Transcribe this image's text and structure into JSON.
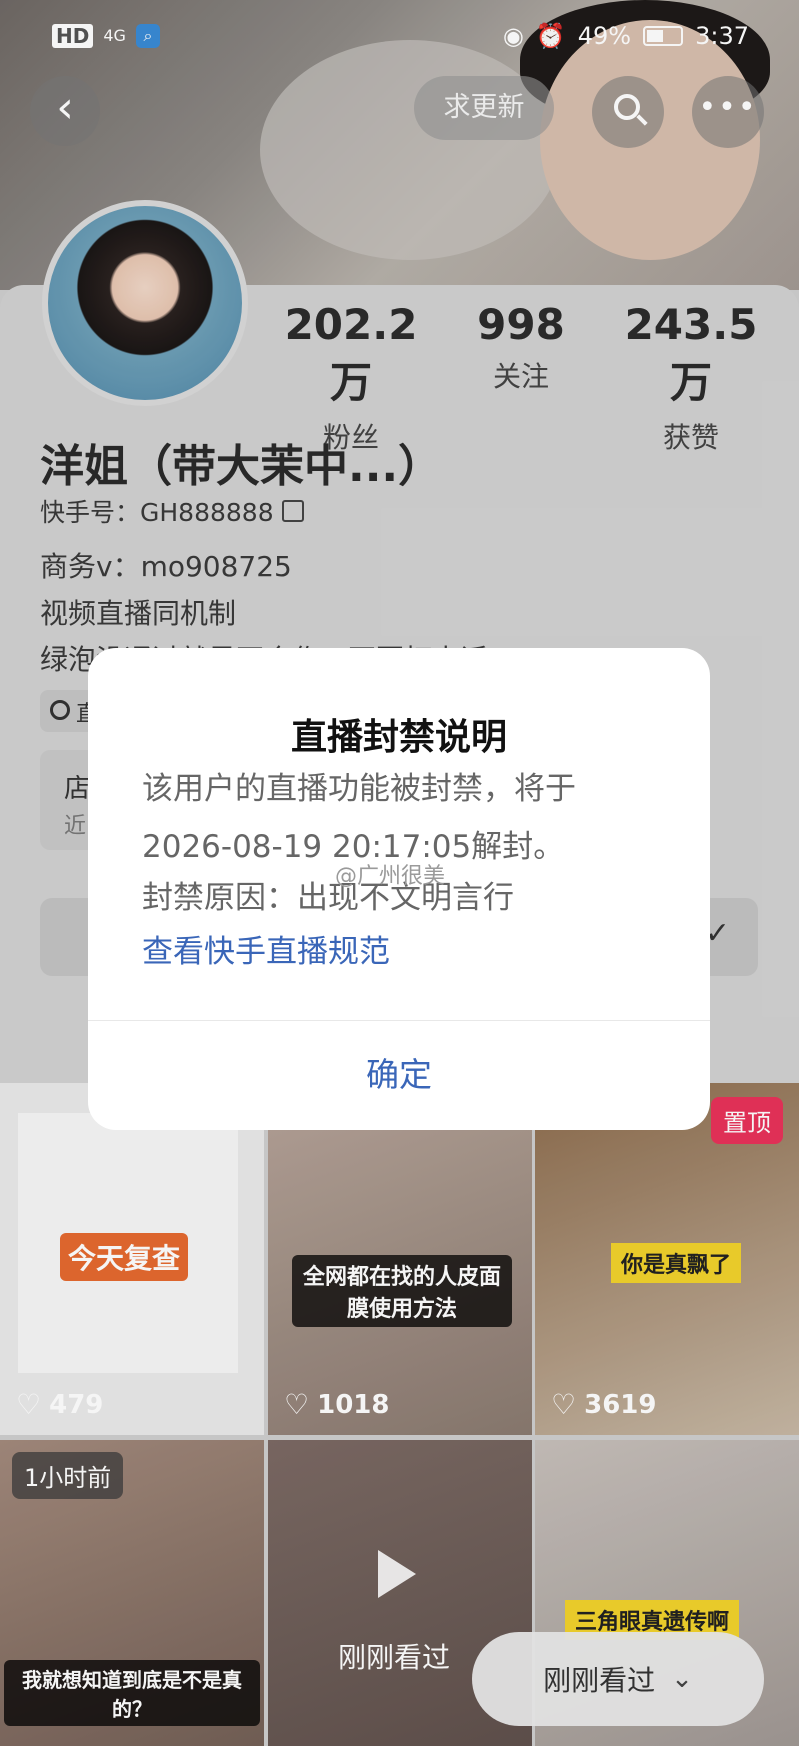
{
  "status_bar": {
    "network": "HD",
    "signal": "4G",
    "battery": "49%",
    "time": "3:37"
  },
  "header": {
    "back_icon": "chevron-left-icon",
    "update_label": "求更新",
    "search_icon": "search-icon",
    "more_icon": "more-icon"
  },
  "profile": {
    "stats": [
      {
        "value": "202.2万",
        "label": "粉丝"
      },
      {
        "value": "998",
        "label": "关注"
      },
      {
        "value": "243.5万",
        "label": "获赞"
      }
    ],
    "name": "洋姐（带大茉中...）",
    "id_label": "快手号：GH888888",
    "bio": [
      "商务v：mo908725",
      "视频直播同机制",
      "绿泡没通过就是不合作，不要打电话"
    ],
    "chip_text": "直",
    "shop_text": "店",
    "shop_sub": "近"
  },
  "videos": [
    {
      "likes": "479",
      "caption": "今天复查"
    },
    {
      "likes": "1018",
      "caption": "全网都在找的人皮面膜使用方法"
    },
    {
      "likes": "3619",
      "caption": "你是真飘了",
      "pinned": "置顶"
    },
    {
      "tag": "1小时前",
      "caption": "我就想知道到底是不是真的？"
    },
    {
      "caption": "刚刚看过"
    },
    {
      "caption": "三角眼真遗传啊"
    }
  ],
  "recently_viewed": "刚刚看过",
  "modal": {
    "title": "直播封禁说明",
    "body": "该用户的直播功能被封禁，将于2026-08-19 20:17:05解封。",
    "reason": "封禁原因：出现不文明言行",
    "link": "查看快手直播规范",
    "ok": "确定"
  },
  "watermark": "@广州很美"
}
